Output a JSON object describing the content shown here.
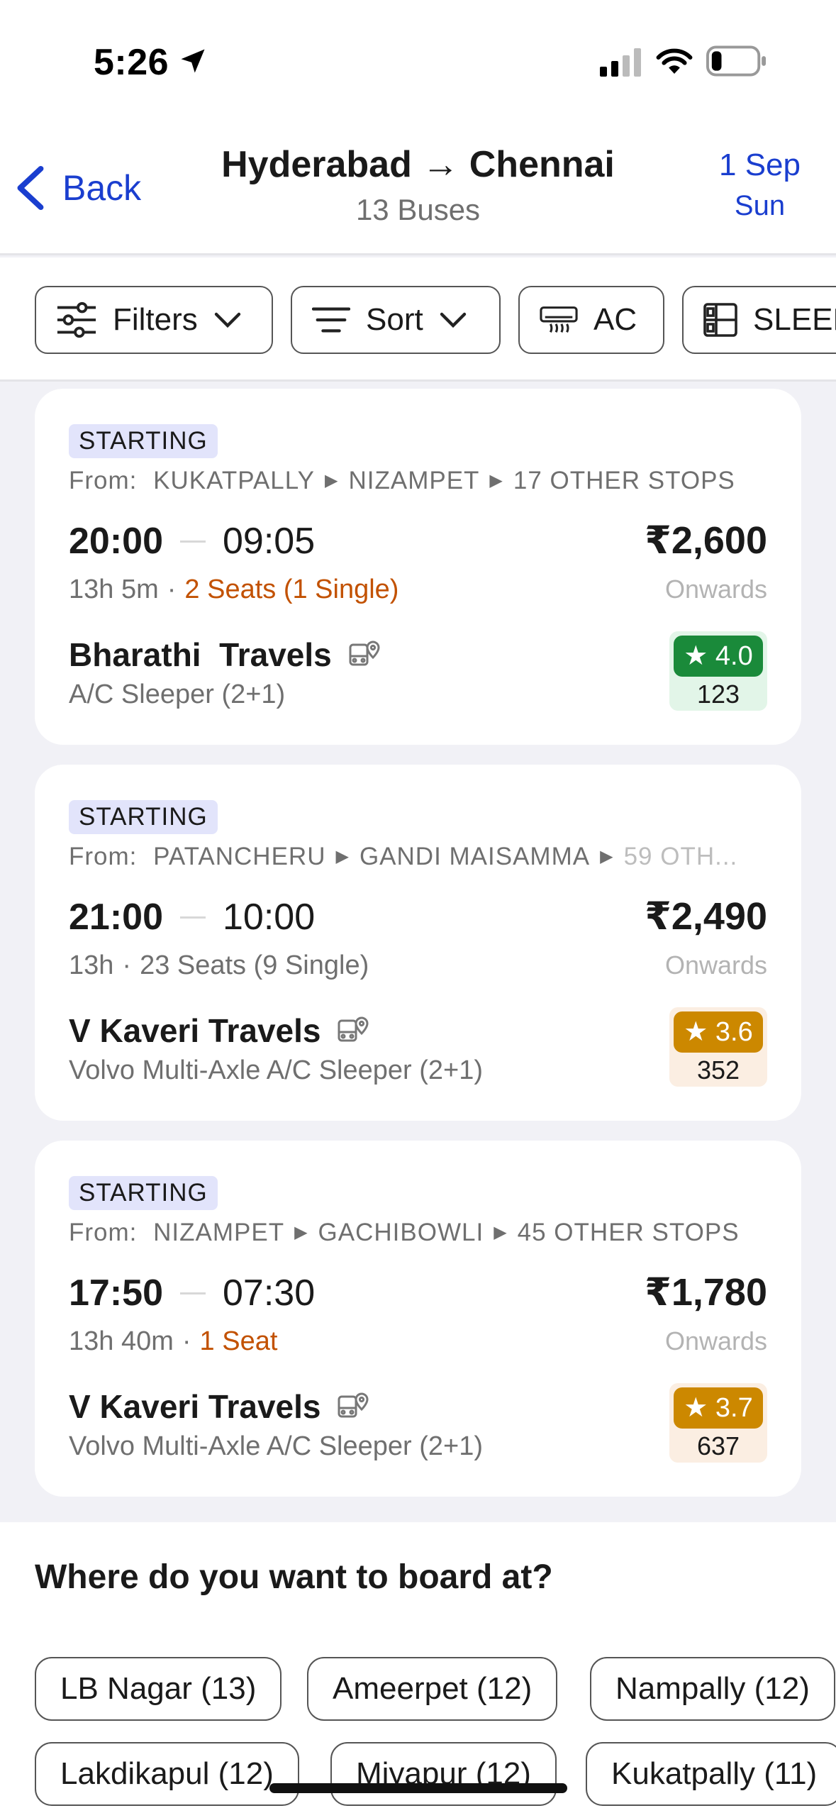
{
  "status_bar": {
    "time": "5:26",
    "icons": [
      "location-arrow-icon",
      "cellular-signal-icon",
      "wifi-icon",
      "battery-icon"
    ]
  },
  "header": {
    "back_label": "Back",
    "title": "Hyderabad → Chennai",
    "subtitle": "13 Buses",
    "date_day": "1 Sep",
    "date_weekday": "Sun"
  },
  "filters": [
    {
      "label": "Filters",
      "icon": "sliders-icon",
      "dropdown": true
    },
    {
      "label": "Sort",
      "icon": "sort-lines-icon",
      "dropdown": true
    },
    {
      "label": "AC",
      "icon": "ac-unit-icon",
      "dropdown": false
    },
    {
      "label": "SLEEPER",
      "icon": "sleeper-berth-icon",
      "dropdown": false
    }
  ],
  "buses": [
    {
      "badge": "STARTING",
      "from_label": "From:",
      "stops": [
        "KUKATPALLY",
        "NIZAMPET",
        "17 OTHER STOPS"
      ],
      "departure": "20:00",
      "arrival": "09:05",
      "duration": "13h 5m",
      "seats": "2 Seats (1 Single)",
      "seats_low": true,
      "price": "₹2,600",
      "price_note": "Onwards",
      "operator": "Bharathi  Travels",
      "bus_type": "A/C Sleeper (2+1)",
      "rating": "★ 4.0",
      "rating_count": "123",
      "rating_color": "green"
    },
    {
      "badge": "STARTING",
      "from_label": "From:",
      "stops": [
        "PATANCHERU",
        "GANDI MAISAMMA",
        "59 OTH..."
      ],
      "departure": "21:00",
      "arrival": "10:00",
      "duration": "13h",
      "seats": "23 Seats (9 Single)",
      "seats_low": false,
      "price": "₹2,490",
      "price_note": "Onwards",
      "operator": "V Kaveri Travels",
      "bus_type": "Volvo Multi-Axle A/C Sleeper (2+1)",
      "rating": "★ 3.6",
      "rating_count": "352",
      "rating_color": "amber"
    },
    {
      "badge": "STARTING",
      "from_label": "From:",
      "stops": [
        "NIZAMPET",
        "GACHIBOWLI",
        "45 OTHER STOPS"
      ],
      "departure": "17:50",
      "arrival": "07:30",
      "duration": "13h 40m",
      "seats": "1 Seat",
      "seats_low": true,
      "price": "₹1,780",
      "price_note": "Onwards",
      "operator": "V Kaveri Travels",
      "bus_type": "Volvo Multi-Axle A/C Sleeper (2+1)",
      "rating": "★ 3.7",
      "rating_count": "637",
      "rating_color": "amber"
    }
  ],
  "boarding": {
    "title": "Where do you want to board at?",
    "rows": [
      [
        "LB Nagar (13)",
        "Ameerpet (12)",
        "Nampally (12)"
      ],
      [
        "Lakdikapul (12)",
        "Miyapur (12)",
        "Kukatpally (11)"
      ]
    ]
  },
  "colors": {
    "accent": "#1a3ecf",
    "warning": "#c25100",
    "rating_green": "#1a8a3a",
    "rating_amber": "#cc8800"
  }
}
